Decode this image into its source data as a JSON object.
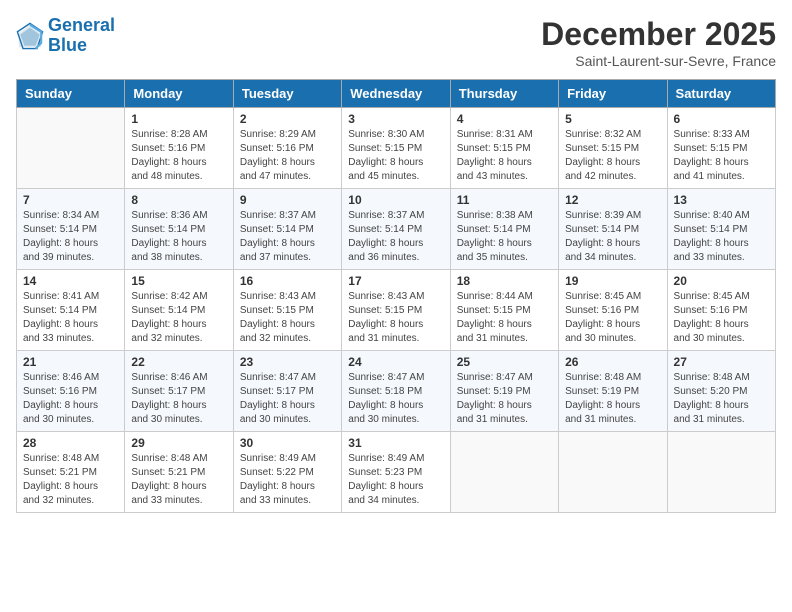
{
  "header": {
    "logo_line1": "General",
    "logo_line2": "Blue",
    "month": "December 2025",
    "location": "Saint-Laurent-sur-Sevre, France"
  },
  "days_of_week": [
    "Sunday",
    "Monday",
    "Tuesday",
    "Wednesday",
    "Thursday",
    "Friday",
    "Saturday"
  ],
  "weeks": [
    [
      {
        "day": "",
        "sunrise": "",
        "sunset": "",
        "daylight": ""
      },
      {
        "day": "1",
        "sunrise": "Sunrise: 8:28 AM",
        "sunset": "Sunset: 5:16 PM",
        "daylight": "Daylight: 8 hours and 48 minutes."
      },
      {
        "day": "2",
        "sunrise": "Sunrise: 8:29 AM",
        "sunset": "Sunset: 5:16 PM",
        "daylight": "Daylight: 8 hours and 47 minutes."
      },
      {
        "day": "3",
        "sunrise": "Sunrise: 8:30 AM",
        "sunset": "Sunset: 5:15 PM",
        "daylight": "Daylight: 8 hours and 45 minutes."
      },
      {
        "day": "4",
        "sunrise": "Sunrise: 8:31 AM",
        "sunset": "Sunset: 5:15 PM",
        "daylight": "Daylight: 8 hours and 43 minutes."
      },
      {
        "day": "5",
        "sunrise": "Sunrise: 8:32 AM",
        "sunset": "Sunset: 5:15 PM",
        "daylight": "Daylight: 8 hours and 42 minutes."
      },
      {
        "day": "6",
        "sunrise": "Sunrise: 8:33 AM",
        "sunset": "Sunset: 5:15 PM",
        "daylight": "Daylight: 8 hours and 41 minutes."
      }
    ],
    [
      {
        "day": "7",
        "sunrise": "Sunrise: 8:34 AM",
        "sunset": "Sunset: 5:14 PM",
        "daylight": "Daylight: 8 hours and 39 minutes."
      },
      {
        "day": "8",
        "sunrise": "Sunrise: 8:36 AM",
        "sunset": "Sunset: 5:14 PM",
        "daylight": "Daylight: 8 hours and 38 minutes."
      },
      {
        "day": "9",
        "sunrise": "Sunrise: 8:37 AM",
        "sunset": "Sunset: 5:14 PM",
        "daylight": "Daylight: 8 hours and 37 minutes."
      },
      {
        "day": "10",
        "sunrise": "Sunrise: 8:37 AM",
        "sunset": "Sunset: 5:14 PM",
        "daylight": "Daylight: 8 hours and 36 minutes."
      },
      {
        "day": "11",
        "sunrise": "Sunrise: 8:38 AM",
        "sunset": "Sunset: 5:14 PM",
        "daylight": "Daylight: 8 hours and 35 minutes."
      },
      {
        "day": "12",
        "sunrise": "Sunrise: 8:39 AM",
        "sunset": "Sunset: 5:14 PM",
        "daylight": "Daylight: 8 hours and 34 minutes."
      },
      {
        "day": "13",
        "sunrise": "Sunrise: 8:40 AM",
        "sunset": "Sunset: 5:14 PM",
        "daylight": "Daylight: 8 hours and 33 minutes."
      }
    ],
    [
      {
        "day": "14",
        "sunrise": "Sunrise: 8:41 AM",
        "sunset": "Sunset: 5:14 PM",
        "daylight": "Daylight: 8 hours and 33 minutes."
      },
      {
        "day": "15",
        "sunrise": "Sunrise: 8:42 AM",
        "sunset": "Sunset: 5:14 PM",
        "daylight": "Daylight: 8 hours and 32 minutes."
      },
      {
        "day": "16",
        "sunrise": "Sunrise: 8:43 AM",
        "sunset": "Sunset: 5:15 PM",
        "daylight": "Daylight: 8 hours and 32 minutes."
      },
      {
        "day": "17",
        "sunrise": "Sunrise: 8:43 AM",
        "sunset": "Sunset: 5:15 PM",
        "daylight": "Daylight: 8 hours and 31 minutes."
      },
      {
        "day": "18",
        "sunrise": "Sunrise: 8:44 AM",
        "sunset": "Sunset: 5:15 PM",
        "daylight": "Daylight: 8 hours and 31 minutes."
      },
      {
        "day": "19",
        "sunrise": "Sunrise: 8:45 AM",
        "sunset": "Sunset: 5:16 PM",
        "daylight": "Daylight: 8 hours and 30 minutes."
      },
      {
        "day": "20",
        "sunrise": "Sunrise: 8:45 AM",
        "sunset": "Sunset: 5:16 PM",
        "daylight": "Daylight: 8 hours and 30 minutes."
      }
    ],
    [
      {
        "day": "21",
        "sunrise": "Sunrise: 8:46 AM",
        "sunset": "Sunset: 5:16 PM",
        "daylight": "Daylight: 8 hours and 30 minutes."
      },
      {
        "day": "22",
        "sunrise": "Sunrise: 8:46 AM",
        "sunset": "Sunset: 5:17 PM",
        "daylight": "Daylight: 8 hours and 30 minutes."
      },
      {
        "day": "23",
        "sunrise": "Sunrise: 8:47 AM",
        "sunset": "Sunset: 5:17 PM",
        "daylight": "Daylight: 8 hours and 30 minutes."
      },
      {
        "day": "24",
        "sunrise": "Sunrise: 8:47 AM",
        "sunset": "Sunset: 5:18 PM",
        "daylight": "Daylight: 8 hours and 30 minutes."
      },
      {
        "day": "25",
        "sunrise": "Sunrise: 8:47 AM",
        "sunset": "Sunset: 5:19 PM",
        "daylight": "Daylight: 8 hours and 31 minutes."
      },
      {
        "day": "26",
        "sunrise": "Sunrise: 8:48 AM",
        "sunset": "Sunset: 5:19 PM",
        "daylight": "Daylight: 8 hours and 31 minutes."
      },
      {
        "day": "27",
        "sunrise": "Sunrise: 8:48 AM",
        "sunset": "Sunset: 5:20 PM",
        "daylight": "Daylight: 8 hours and 31 minutes."
      }
    ],
    [
      {
        "day": "28",
        "sunrise": "Sunrise: 8:48 AM",
        "sunset": "Sunset: 5:21 PM",
        "daylight": "Daylight: 8 hours and 32 minutes."
      },
      {
        "day": "29",
        "sunrise": "Sunrise: 8:48 AM",
        "sunset": "Sunset: 5:21 PM",
        "daylight": "Daylight: 8 hours and 33 minutes."
      },
      {
        "day": "30",
        "sunrise": "Sunrise: 8:49 AM",
        "sunset": "Sunset: 5:22 PM",
        "daylight": "Daylight: 8 hours and 33 minutes."
      },
      {
        "day": "31",
        "sunrise": "Sunrise: 8:49 AM",
        "sunset": "Sunset: 5:23 PM",
        "daylight": "Daylight: 8 hours and 34 minutes."
      },
      {
        "day": "",
        "sunrise": "",
        "sunset": "",
        "daylight": ""
      },
      {
        "day": "",
        "sunrise": "",
        "sunset": "",
        "daylight": ""
      },
      {
        "day": "",
        "sunrise": "",
        "sunset": "",
        "daylight": ""
      }
    ]
  ]
}
